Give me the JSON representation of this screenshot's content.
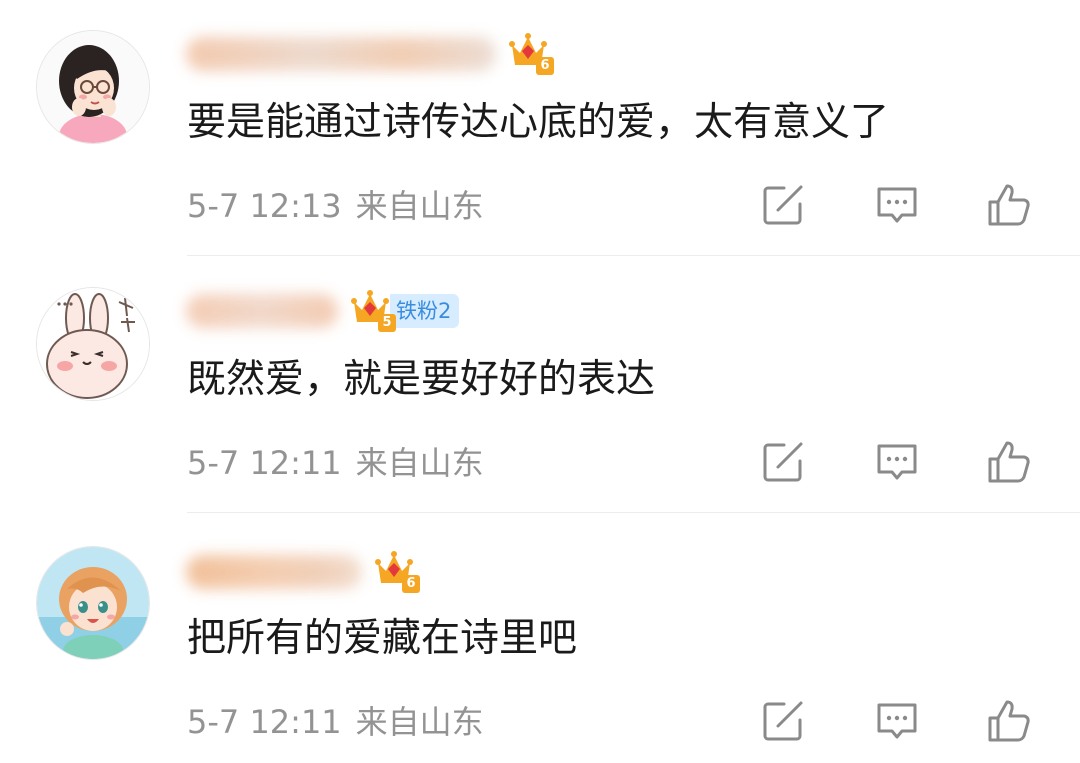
{
  "comments": [
    {
      "text": "要是能通过诗传达心底的爱，太有意义了",
      "time": "5-7 12:13",
      "location": "来自山东",
      "level": "6",
      "fan_badge": "",
      "avatar_icon": "girl-glasses-avatar"
    },
    {
      "text": "既然爱，就是要好好的表达",
      "time": "5-7 12:11",
      "location": "来自山东",
      "level": "5",
      "fan_badge": "铁粉2",
      "avatar_icon": "bunny-avatar"
    },
    {
      "text": "把所有的爱藏在诗里吧",
      "time": "5-7 12:11",
      "location": "来自山东",
      "level": "6",
      "fan_badge": "",
      "avatar_icon": "anime-girl-avatar"
    }
  ],
  "icons": {
    "repost": "repost-icon",
    "comment": "comment-icon",
    "like": "thumbs-up-icon",
    "crown": "crown-icon"
  },
  "colors": {
    "text": "#1a1a1a",
    "meta": "#939393",
    "crown": "#f5a623",
    "fan_badge_bg": "#d7ecff",
    "fan_badge_text": "#3a8dde"
  }
}
